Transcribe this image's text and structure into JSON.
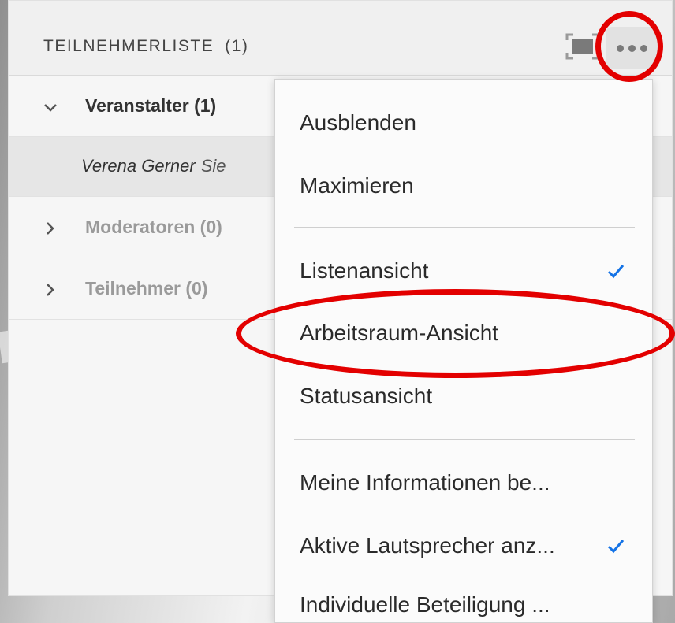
{
  "pod": {
    "title": "TEILNEHMERLISTE",
    "count": "(1)"
  },
  "tree": {
    "hosts": {
      "label": "Veranstalter (1)"
    },
    "host_user": {
      "name": "Verena Gerner",
      "suffix": "Sie"
    },
    "presenters": {
      "label": "Moderatoren (0)"
    },
    "participants": {
      "label": "Teilnehmer (0)"
    }
  },
  "menu": {
    "items": [
      {
        "label": "Ausblenden",
        "checked": false
      },
      {
        "label": "Maximieren",
        "checked": false
      },
      {
        "label": "Listenansicht",
        "checked": true
      },
      {
        "label": "Arbeitsraum-Ansicht",
        "checked": false
      },
      {
        "label": "Statusansicht",
        "checked": false
      },
      {
        "label": "Meine Informationen be...",
        "checked": false
      },
      {
        "label": "Aktive Lautsprecher anz...",
        "checked": true
      },
      {
        "label": "Individuelle Beteiligung ...",
        "checked": false
      }
    ]
  },
  "colors": {
    "accent": "#1473e6",
    "annotation": "#e30000"
  },
  "icons": {
    "fullscreen": "fullscreen-icon",
    "more": "more-options-icon",
    "check": "checkmark-icon",
    "expanded": "chevron-down-icon",
    "collapsed": "chevron-right-icon"
  }
}
